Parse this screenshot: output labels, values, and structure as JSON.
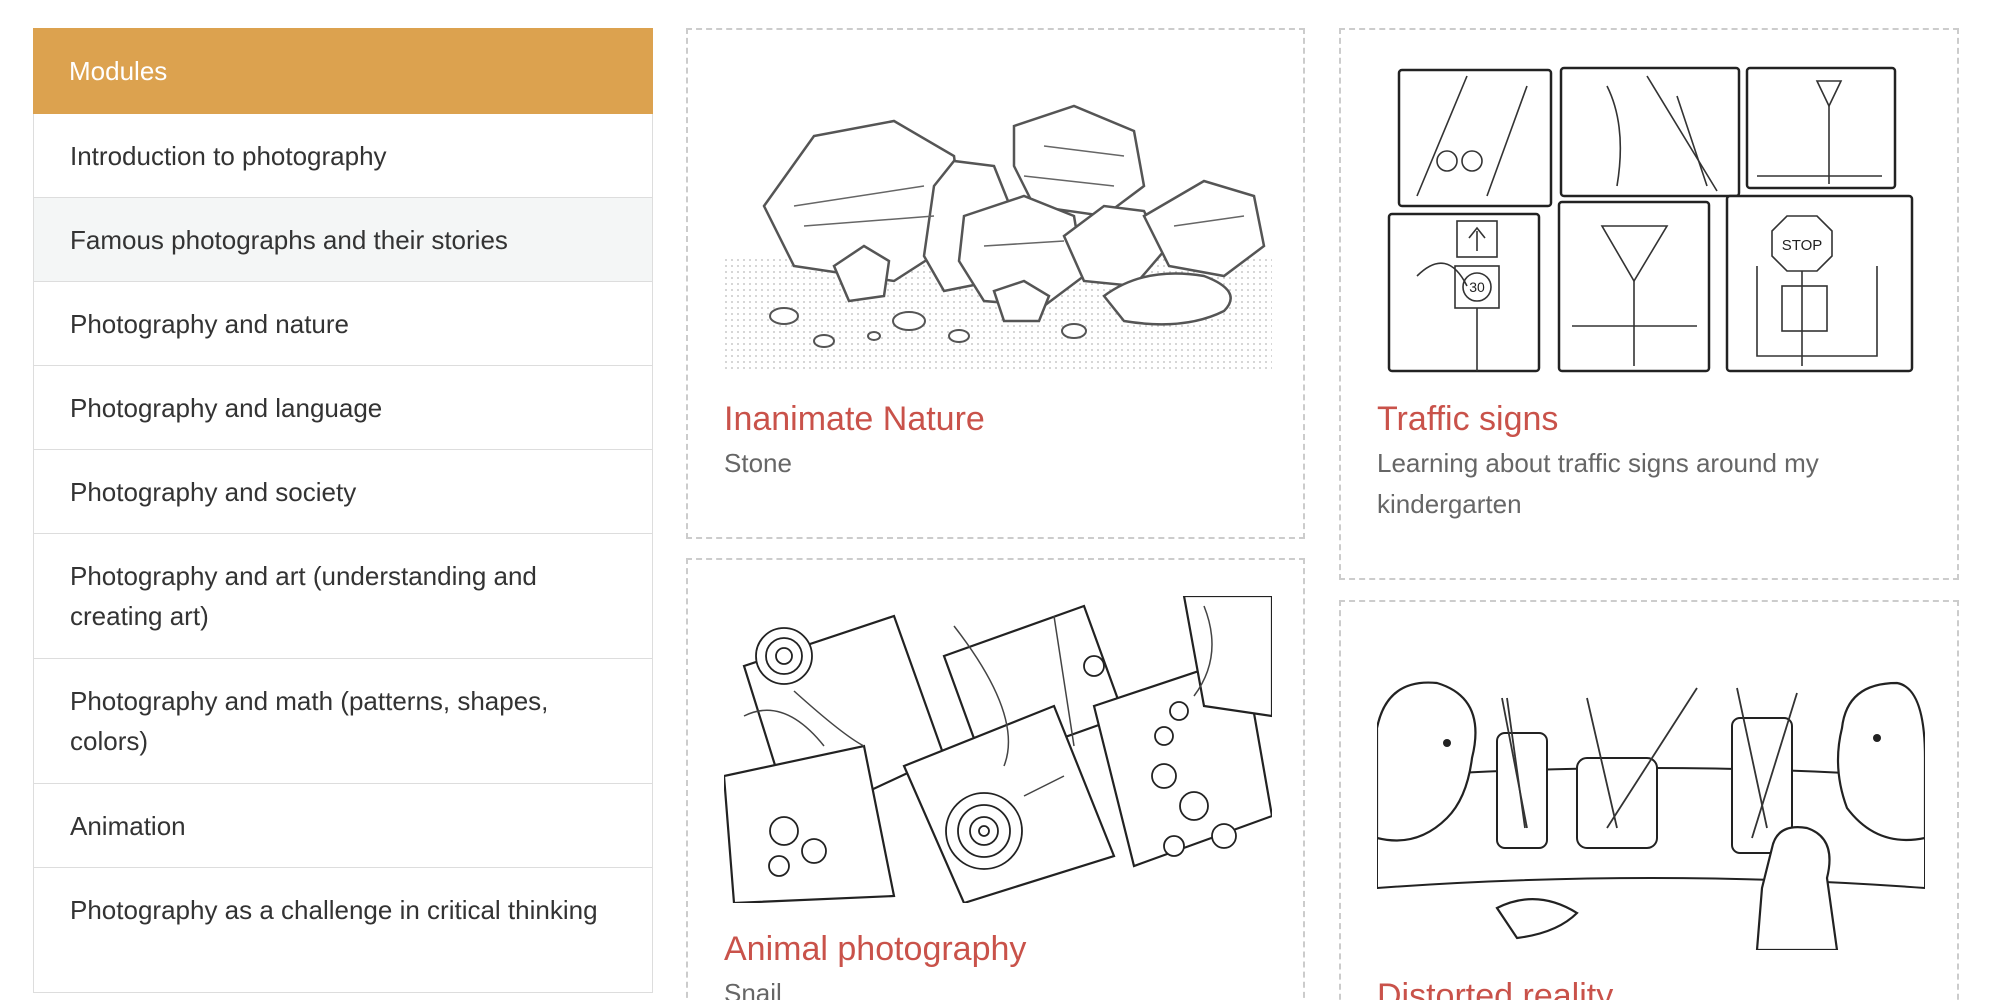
{
  "sidebar": {
    "header": "Modules",
    "items": [
      {
        "label": "Introduction to photography"
      },
      {
        "label": "Famous photographs and their stories"
      },
      {
        "label": "Photography and nature"
      },
      {
        "label": "Photography and language"
      },
      {
        "label": "Photography and society"
      },
      {
        "label": "Photography and art (understanding and creating art)"
      },
      {
        "label": "Photography and math (patterns, shapes, colors)"
      },
      {
        "label": "Animation"
      },
      {
        "label": "Photography as a challenge in critical thinking"
      }
    ]
  },
  "cards": [
    {
      "title": "Inanimate Nature",
      "subtitle": "Stone",
      "icon": "rocks-illustration"
    },
    {
      "title": "Traffic signs",
      "subtitle": "Learning about traffic signs around my kindergarten",
      "icon": "traffic-signs-illustration"
    },
    {
      "title": "Animal photography",
      "subtitle": "Snail",
      "icon": "snails-illustration"
    },
    {
      "title": "Distorted reality",
      "subtitle": "",
      "icon": "glasses-illustration"
    }
  ],
  "colors": {
    "accent": "#dca24f",
    "card_title": "#c9524a",
    "active_item_bg": "#f4f6f6"
  }
}
